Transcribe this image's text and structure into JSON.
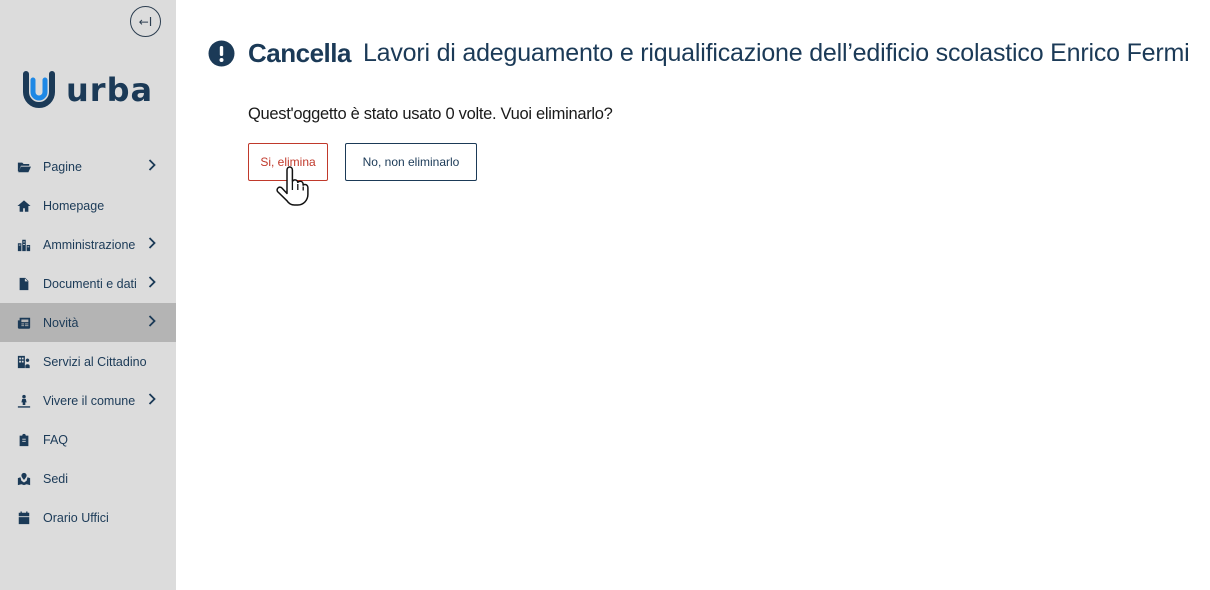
{
  "sidebar": {
    "collapse_label": "←I",
    "logo_text": "urba",
    "items": [
      {
        "label": "Pagine",
        "icon": "folder-open-icon",
        "chevron": true,
        "active": false
      },
      {
        "label": "Homepage",
        "icon": "home-icon",
        "chevron": false,
        "active": false
      },
      {
        "label": "Amministrazione",
        "icon": "city-icon",
        "chevron": true,
        "active": false
      },
      {
        "label": "Documenti e dati",
        "icon": "file-icon",
        "chevron": true,
        "active": false
      },
      {
        "label": "Novità",
        "icon": "newspaper-icon",
        "chevron": true,
        "active": true
      },
      {
        "label": "Servizi al Cittadino",
        "icon": "building-user-icon",
        "chevron": false,
        "active": false
      },
      {
        "label": "Vivere il comune",
        "icon": "person-pin-icon",
        "chevron": true,
        "active": false
      },
      {
        "label": "FAQ",
        "icon": "clipboard-icon",
        "chevron": false,
        "active": false
      },
      {
        "label": "Sedi",
        "icon": "map-location-icon",
        "chevron": false,
        "active": false
      },
      {
        "label": "Orario Uffici",
        "icon": "calendar-icon",
        "chevron": false,
        "active": false
      }
    ]
  },
  "main": {
    "title_strong": "Cancella",
    "title_object": "Lavori di adeguamento e riqualificazione dell’edificio scolastico Enrico Fermi",
    "question": "Quest'oggetto è stato usato 0 volte. Vuoi eliminarlo?",
    "confirm_label": "Si, elimina",
    "cancel_label": "No, non eliminarlo"
  },
  "colors": {
    "brand": "#1b3a57",
    "logo_accent": "#1e88e5",
    "danger": "#c0392b",
    "sidebar_bg": "#dcdcdc",
    "sidebar_active": "#b4b4b4"
  }
}
